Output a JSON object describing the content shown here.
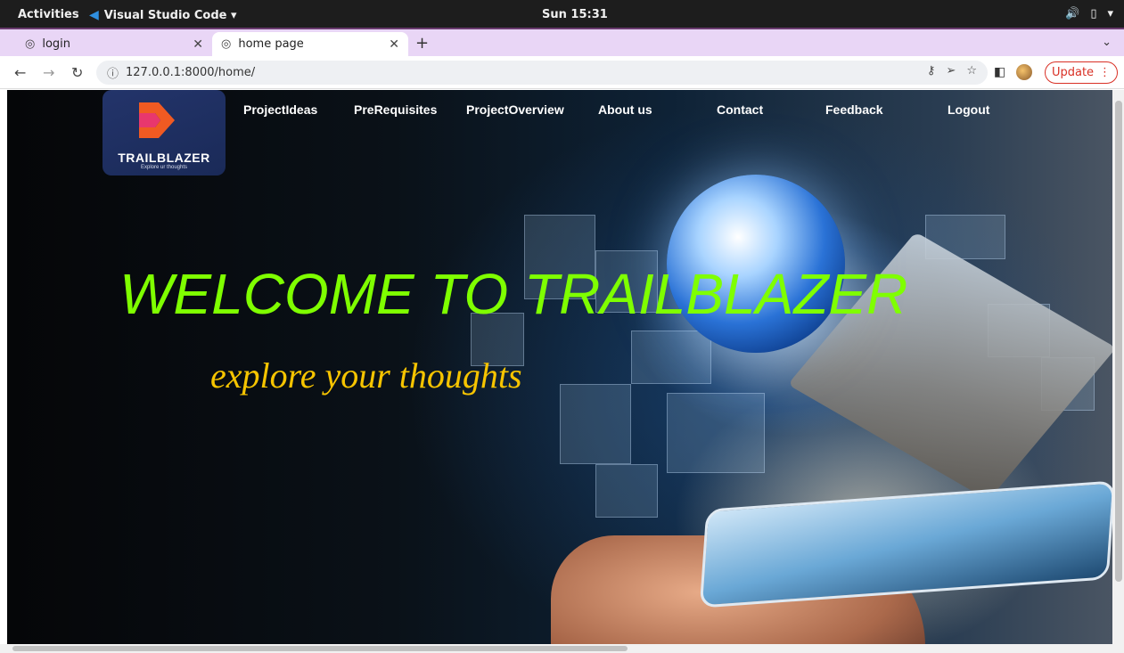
{
  "system_bar": {
    "activities": "Activities",
    "app_name": "Visual Studio Code ▾",
    "clock": "Sun 15:31"
  },
  "tabs": [
    {
      "title": "login",
      "active": false
    },
    {
      "title": "home page",
      "active": true
    }
  ],
  "address_bar": {
    "url": "127.0.0.1:8000/home/",
    "update_label": "Update"
  },
  "site": {
    "logo": {
      "brand": "TRAILBLAZER",
      "tagline": "Explore ur thoughts"
    },
    "nav": [
      {
        "label": "ProjectIdeas"
      },
      {
        "label": "PreRequisites"
      },
      {
        "label": "ProjectOverview"
      },
      {
        "label": "About us"
      },
      {
        "label": "Contact"
      },
      {
        "label": "Feedback"
      },
      {
        "label": "Logout"
      }
    ],
    "hero": {
      "title": "WELCOME TO TRAILBLAZER",
      "subtitle": "explore your thoughts"
    }
  },
  "colors": {
    "hero_title": "#7fff00",
    "hero_subtitle": "#f6c400",
    "tab_strip": "#e9d6f6",
    "update_accent": "#d93025"
  }
}
